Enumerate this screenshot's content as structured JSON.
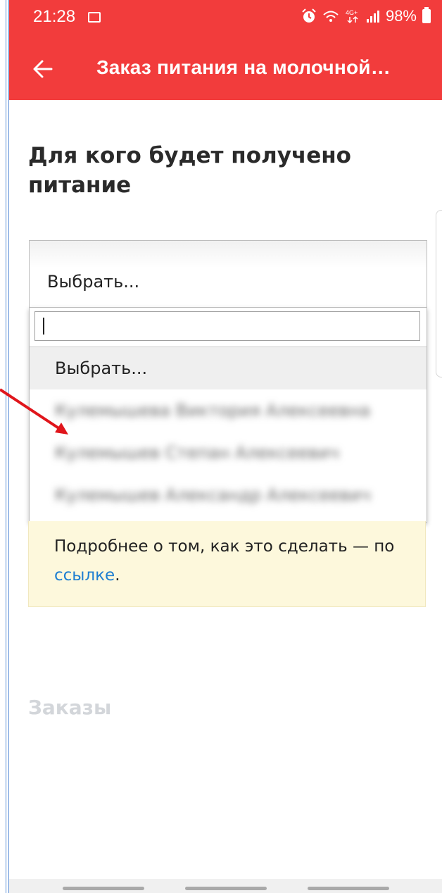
{
  "statusbar": {
    "time": "21:28",
    "battery": "98%",
    "icons": [
      "image-icon",
      "alarm-icon",
      "wifi-icon",
      "4g-icon",
      "signal-icon",
      "battery-icon"
    ]
  },
  "toolbar": {
    "back_icon": "arrow-left-icon",
    "title": "Заказ питания на молочной…"
  },
  "form": {
    "section_title": "Для кого будет получено питание",
    "select_value": "Выбрать...",
    "search_value": "",
    "options": [
      {
        "label": "Выбрать...",
        "selected": true,
        "blurred": false
      },
      {
        "label": "Кулемышева Виктория Алексеевна",
        "selected": false,
        "blurred": true
      },
      {
        "label": "Кулемышев Степан Алексеевич",
        "selected": false,
        "blurred": true
      },
      {
        "label": "Кулемышев Александр Алексеевич",
        "selected": false,
        "blurred": true
      }
    ]
  },
  "info": {
    "text": "Подробнее о том, как это сделать — по ",
    "link_text": "ссылке",
    "text_end": "."
  },
  "orders": {
    "title": "Заказы"
  },
  "colors": {
    "header": "#f23c3c",
    "link": "#1f7fd1",
    "info_bg": "#fdf8dc",
    "annotation_arrow": "#e0151b"
  }
}
